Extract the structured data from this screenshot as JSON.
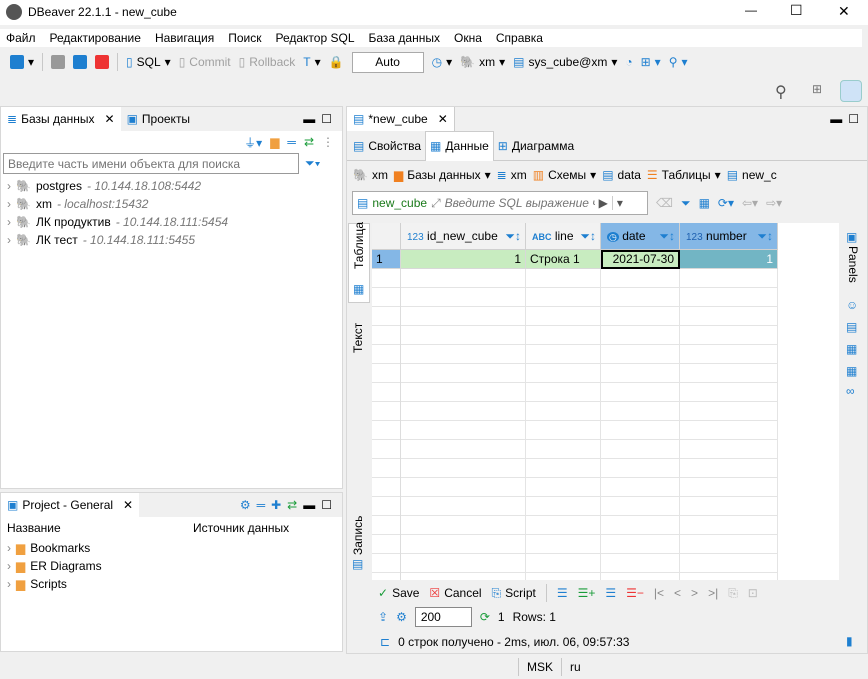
{
  "window": {
    "title": "DBeaver 22.1.1 - new_cube",
    "minimize": "—",
    "maximize": "☐",
    "close": "✕"
  },
  "menu": [
    "Файл",
    "Редактирование",
    "Навигация",
    "Поиск",
    "Редактор SQL",
    "База данных",
    "Окна",
    "Справка"
  ],
  "toolbar": {
    "sql": "SQL",
    "commit": "Commit",
    "rollback": "Rollback",
    "mode": "Auto",
    "datasource": "xm",
    "schema": "sys_cube@xm"
  },
  "left": {
    "tabs": [
      {
        "label": "Базы данных",
        "active": true
      },
      {
        "label": "Проекты"
      }
    ],
    "search_placeholder": "Введите часть имени объекта для поиска",
    "connections": [
      {
        "name": "postgres",
        "host": "10.144.18.108:5442"
      },
      {
        "name": "xm",
        "host": "localhost:15432",
        "connected": true
      },
      {
        "name": "ЛК продуктив",
        "host": "10.144.18.111:5454"
      },
      {
        "name": "ЛК тест",
        "host": "10.144.18.111:5455"
      }
    ],
    "project": {
      "title": "Project - General",
      "columns": [
        "Название",
        "Источник данных"
      ],
      "items": [
        "Bookmarks",
        "ER Diagrams",
        "Scripts"
      ]
    }
  },
  "editor": {
    "tab": "*new_cube",
    "subtabs": [
      "Свойства",
      "Данные",
      "Диаграмма"
    ],
    "breadcrumb": [
      "xm",
      "Базы данных",
      "xm",
      "Схемы",
      "data",
      "Таблицы",
      "new_c"
    ],
    "table_label": "new_cube",
    "filter_placeholder": "Введите SQL выражение ч",
    "side_tabs": [
      "Таблица",
      "Текст",
      "Запись"
    ],
    "right_panel": "Panels",
    "columns": [
      {
        "type": "123",
        "name": "id_new_cube"
      },
      {
        "type": "ABC",
        "name": "line"
      },
      {
        "type": "clock",
        "name": "date"
      },
      {
        "type": "123",
        "name": "number"
      }
    ],
    "rows": [
      {
        "num": "1",
        "cells": [
          "1",
          "Строка 1",
          "2021-07-30",
          "1"
        ]
      }
    ],
    "actions": {
      "save": "Save",
      "cancel": "Cancel",
      "script": "Script"
    },
    "fetch_size": "200",
    "refresh_count": "1",
    "rows_label": "Rows: 1",
    "status": "0 строк получено - 2ms, июл. 06, 09:57:33"
  },
  "statusbar": {
    "tz": "MSK",
    "locale": "ru"
  },
  "colors": {
    "accent": "#1e7fd0",
    "modified_cell": "#c8ecc0",
    "selected": "#84b7e6",
    "number_cell": "#72b5c4"
  }
}
